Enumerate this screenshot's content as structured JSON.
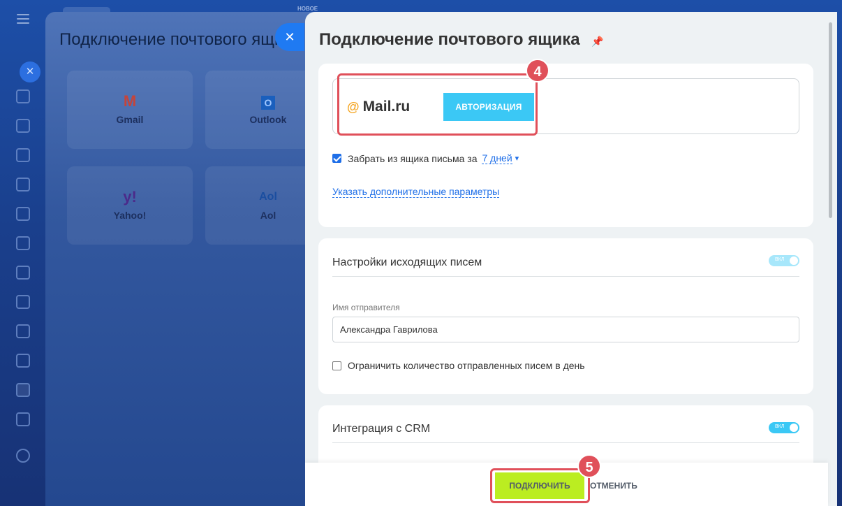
{
  "background_slider": {
    "title": "Подключение почтового ящика",
    "new_label": "НОВОЕ",
    "services": [
      {
        "name": "Gmail",
        "logo": "M"
      },
      {
        "name": "Outlook",
        "logo": "O"
      },
      {
        "name": "Yahoo!",
        "logo": "y!"
      },
      {
        "name": "Aol",
        "logo": "Aol"
      }
    ]
  },
  "panel": {
    "title": "Подключение почтового ящика",
    "provider": {
      "at": "@",
      "name": "Mail.ru"
    },
    "auth_button": "АВТОРИЗАЦИЯ",
    "fetch_label": "Забрать из ящика письма за",
    "fetch_period": "7 дней",
    "advanced_link": "Указать дополнительные параметры",
    "outgoing": {
      "title": "Настройки исходящих писем",
      "toggle_label": "ВКЛ",
      "sender_label": "Имя отправителя",
      "sender_value": "Александра Гаврилова",
      "limit_label": "Ограничить количество отправленных писем в день"
    },
    "crm": {
      "title": "Интеграция с CRM",
      "toggle_label": "ВКЛ"
    },
    "footer": {
      "connect": "ПОДКЛЮЧИТЬ",
      "cancel": "ОТМЕНИТЬ"
    }
  },
  "badges": {
    "step4": "4",
    "step5": "5"
  },
  "colors": {
    "accent_blue": "#1f6fe8",
    "auth_button": "#3bc8f5",
    "connect_button": "#bbed21",
    "highlight": "#e0505a"
  }
}
